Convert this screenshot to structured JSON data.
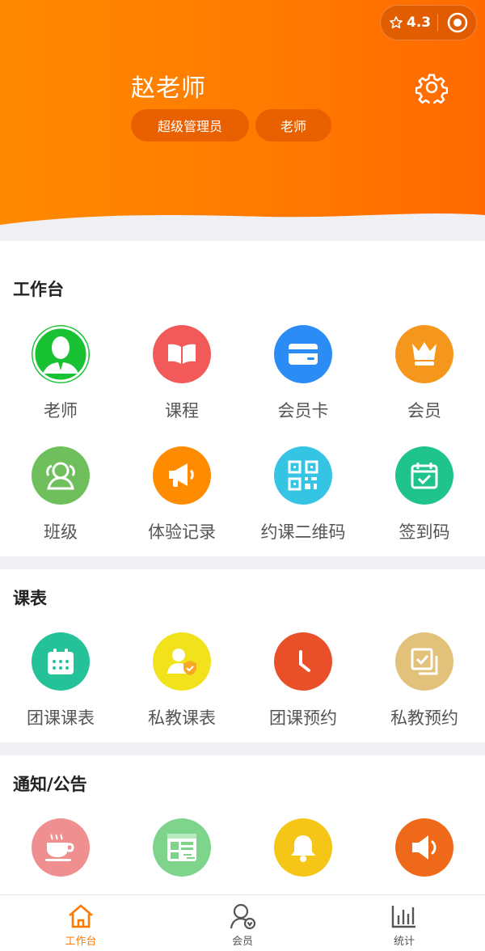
{
  "header": {
    "user_name": "赵老师",
    "tags": [
      "超级管理员",
      "老师"
    ],
    "rating": "4.3",
    "brand_color": "#ff7a00"
  },
  "sections": {
    "workbench": {
      "title": "工作台",
      "items": [
        {
          "label": "老师",
          "icon": "teacher-icon",
          "color": "#19c233"
        },
        {
          "label": "课程",
          "icon": "book-icon",
          "color": "#f25a5a"
        },
        {
          "label": "会员卡",
          "icon": "card-icon",
          "color": "#2b8cf6"
        },
        {
          "label": "会员",
          "icon": "crown-icon",
          "color": "#f5961d"
        },
        {
          "label": "班级",
          "icon": "group-icon",
          "color": "#6fbf5c"
        },
        {
          "label": "体验记录",
          "icon": "megaphone-icon",
          "color": "#ff8c00"
        },
        {
          "label": "约课二维码",
          "icon": "qrcode-icon",
          "color": "#35c4e4"
        },
        {
          "label": "签到码",
          "icon": "calendar-check-icon",
          "color": "#1ec48c"
        }
      ]
    },
    "schedule": {
      "title": "课表",
      "items": [
        {
          "label": "团课课表",
          "icon": "calendar-icon",
          "color": "#25c29a"
        },
        {
          "label": "私教课表",
          "icon": "user-shield-icon",
          "color": "#f2e21c"
        },
        {
          "label": "团课预约",
          "icon": "clock-icon",
          "color": "#e9502a"
        },
        {
          "label": "私教预约",
          "icon": "check-copy-icon",
          "color": "#e2c27a"
        }
      ]
    },
    "notices": {
      "title": "通知/公告",
      "items": [
        {
          "label": "",
          "icon": "coffee-icon",
          "color": "#ef8f8f"
        },
        {
          "label": "",
          "icon": "table-icon",
          "color": "#7ed48b"
        },
        {
          "label": "",
          "icon": "bell-icon",
          "color": "#f5c518"
        },
        {
          "label": "",
          "icon": "speaker-icon",
          "color": "#ee6a1a"
        }
      ]
    }
  },
  "tabbar": {
    "items": [
      {
        "label": "工作台",
        "icon": "home-icon",
        "active": true
      },
      {
        "label": "会员",
        "icon": "member-icon",
        "active": false
      },
      {
        "label": "统计",
        "icon": "chart-icon",
        "active": false
      }
    ]
  }
}
